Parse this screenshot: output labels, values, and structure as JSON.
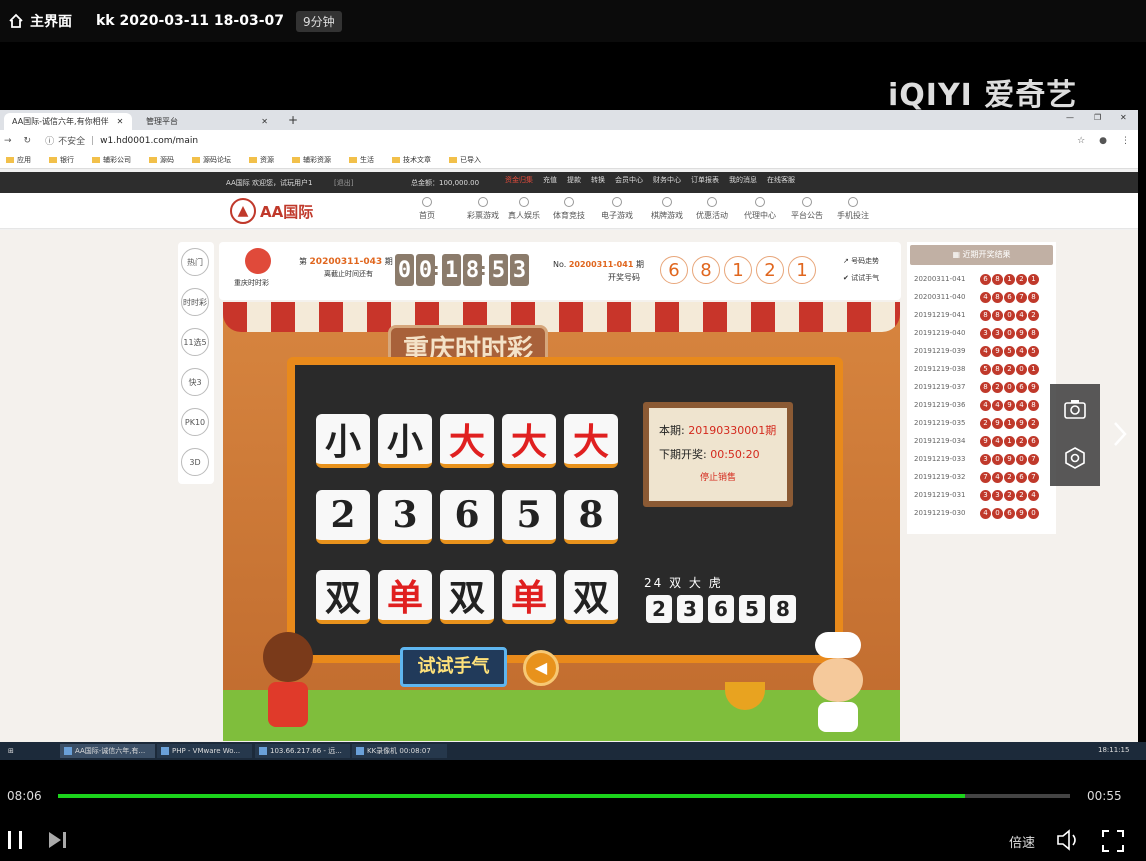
{
  "player": {
    "home_label": "主界面",
    "title": "kk 2020-03-11 18-03-07",
    "duration_badge": "9分钟",
    "logo": "iQIYI 爱奇艺",
    "time_current": "08:06",
    "time_remaining": "00:55",
    "progress_fraction": 0.896,
    "speed_label": "倍速"
  },
  "browser": {
    "tab1": "AA国际-诚信六年,有你相伴",
    "tab2": "管理平台",
    "not_secure": "不安全",
    "url": "w1.hd0001.com/main",
    "bookmarks": [
      "应用",
      "银行",
      "辅彩公司",
      "源码",
      "源码论坛",
      "资源",
      "辅彩资源",
      "生活",
      "技术文章",
      "已导入"
    ]
  },
  "site": {
    "top_left": "AA国际   欢迎您，试玩用户1",
    "top_exit": "[退出]",
    "balance": "总金额：100,000.00",
    "top_links": [
      "资金归集",
      "充值",
      "提款",
      "转换",
      "会员中心",
      "财务中心",
      "订单报表",
      "我的消息",
      "在线客服"
    ],
    "brand": "AA国际",
    "nav": [
      "首页",
      "彩票游戏",
      "真人娱乐",
      "体育竞技",
      "电子游戏",
      "棋牌游戏",
      "优惠活动",
      "代理中心",
      "平台公告",
      "手机投注"
    ]
  },
  "side_buttons": [
    "热门",
    "时时彩",
    "11选5",
    "快3",
    "PK10",
    "3D"
  ],
  "lotto": {
    "game_name": "重庆时时彩",
    "period_prefix": "第",
    "period": "20200311-043",
    "period_suffix": "期",
    "deadline_label": "离截止时间还有",
    "countdown": [
      "0",
      "0",
      "1",
      "8",
      "5",
      "3"
    ],
    "last_prefix": "No.",
    "last_period": "20200311-041",
    "last_suffix": "期",
    "last_label": "开奖号码",
    "last_numbers": [
      "6",
      "8",
      "1",
      "2",
      "1"
    ],
    "trend_link": "号码走势",
    "try_link": "试试手气"
  },
  "scene": {
    "title": "重庆时时彩",
    "row_size": [
      "小",
      "小",
      "大",
      "大",
      "大"
    ],
    "row_nums": [
      "2",
      "3",
      "6",
      "5",
      "8"
    ],
    "row_parity": [
      "双",
      "单",
      "双",
      "单",
      "双"
    ],
    "current_label": "本期:",
    "current_period": "20190330001期",
    "next_label": "下期开奖:",
    "next_time": "00:50:20",
    "stop_label": "停止销售",
    "sum_text": "24 双 大 虎",
    "sum_digits": [
      "2",
      "3",
      "6",
      "5",
      "8"
    ],
    "try_button": "试试手气"
  },
  "history": {
    "header": "近期开奖结果",
    "rows": [
      {
        "period": "20200311-041",
        "nums": [
          "6",
          "8",
          "1",
          "2",
          "1"
        ]
      },
      {
        "period": "20200311-040",
        "nums": [
          "4",
          "8",
          "6",
          "7",
          "8"
        ]
      },
      {
        "period": "20191219-041",
        "nums": [
          "8",
          "8",
          "0",
          "4",
          "2"
        ]
      },
      {
        "period": "20191219-040",
        "nums": [
          "3",
          "3",
          "0",
          "9",
          "8"
        ]
      },
      {
        "period": "20191219-039",
        "nums": [
          "4",
          "9",
          "5",
          "4",
          "5"
        ]
      },
      {
        "period": "20191219-038",
        "nums": [
          "5",
          "8",
          "2",
          "0",
          "1"
        ]
      },
      {
        "period": "20191219-037",
        "nums": [
          "8",
          "2",
          "0",
          "6",
          "9"
        ]
      },
      {
        "period": "20191219-036",
        "nums": [
          "4",
          "4",
          "9",
          "4",
          "8"
        ]
      },
      {
        "period": "20191219-035",
        "nums": [
          "2",
          "9",
          "1",
          "9",
          "2"
        ]
      },
      {
        "period": "20191219-034",
        "nums": [
          "9",
          "4",
          "1",
          "2",
          "6"
        ]
      },
      {
        "period": "20191219-033",
        "nums": [
          "3",
          "0",
          "9",
          "0",
          "7"
        ]
      },
      {
        "period": "20191219-032",
        "nums": [
          "7",
          "4",
          "2",
          "6",
          "7"
        ]
      },
      {
        "period": "20191219-031",
        "nums": [
          "3",
          "3",
          "2",
          "2",
          "4"
        ]
      },
      {
        "period": "20191219-030",
        "nums": [
          "4",
          "0",
          "6",
          "9",
          "0"
        ]
      }
    ]
  },
  "taskbar": {
    "items": [
      "AA国际-诚信六年,有...",
      "PHP - VMware Wo...",
      "103.66.217.66 - 远...",
      "KK录像机 00:08:07"
    ],
    "clock": "18:11:15"
  }
}
